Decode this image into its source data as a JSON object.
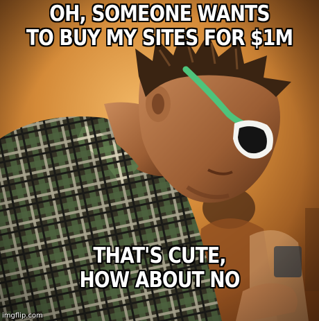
{
  "meme": {
    "top_text": [
      "OH, SOMEONE WANTS",
      "TO BUY MY SITES FOR $1M"
    ],
    "bottom_text": [
      "THAT'S CUTE,",
      "HOW ABOUT NO"
    ],
    "watermark": "imgflip.com"
  },
  "colors": {
    "background_orange": "#c9782c",
    "text": "#ffffff",
    "text_outline": "#000000",
    "sunglasses_frame": "#4ec47c"
  }
}
